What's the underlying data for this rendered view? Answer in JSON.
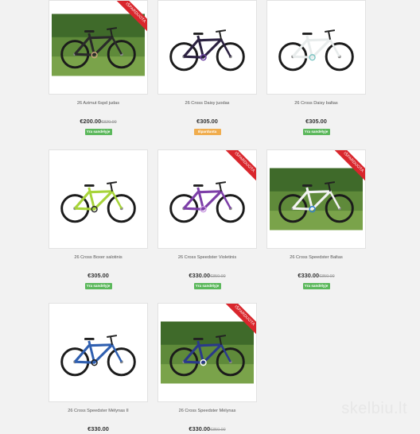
{
  "colors": {
    "in_stock": "#5cb85c",
    "preorder": "#f0ad4e",
    "ribbon": "#d9262c"
  },
  "ribbon_label": "IŠPARDUOTA",
  "products": [
    {
      "name": "26 Azimut 6spd judas",
      "price": "€200.00",
      "old_price": "€320.00",
      "badge": "Yra sandėlyje",
      "badge_type": "in_stock",
      "ribbon": true,
      "photo": "outdoor-photo",
      "frame_color": "#2a2a2a",
      "accent": "#c7a27a"
    },
    {
      "name": "26 Cross Daisy juodas",
      "price": "€305.00",
      "old_price": "",
      "badge": "Išparduota",
      "badge_type": "preorder",
      "ribbon": false,
      "photo": "white",
      "frame_color": "#2b2140",
      "accent": "#6b3fa0"
    },
    {
      "name": "26 Cross Daisy baltas",
      "price": "€305.00",
      "old_price": "",
      "badge": "Yra sandėlyje",
      "badge_type": "in_stock",
      "ribbon": false,
      "photo": "white",
      "frame_color": "#e8ecec",
      "accent": "#7fc6c4"
    },
    {
      "name": "26 Cross Boxer salotinis",
      "price": "€305.00",
      "old_price": "",
      "badge": "Yra sandėlyje",
      "badge_type": "in_stock",
      "ribbon": false,
      "photo": "white",
      "frame_color": "#a7d43a",
      "accent": "#2a2a2a"
    },
    {
      "name": "26 Cross Speedster Violetinis",
      "price": "€330.00",
      "old_price": "€350.00",
      "badge": "Yra sandėlyje",
      "badge_type": "in_stock",
      "ribbon": true,
      "photo": "white",
      "frame_color": "#7d3fa8",
      "accent": "#c99ae0"
    },
    {
      "name": "26 Cross Speedster Baltas",
      "price": "€330.00",
      "old_price": "€350.00",
      "badge": "Yra sandėlyje",
      "badge_type": "in_stock",
      "ribbon": true,
      "photo": "outdoor-photo",
      "frame_color": "#f2f2f2",
      "accent": "#2f7fd0"
    },
    {
      "name": "26 Cross Speedster Mėlynas II",
      "price": "€330.00",
      "old_price": "",
      "badge": "",
      "badge_type": "",
      "ribbon": false,
      "photo": "white",
      "frame_color": "#2f5fb0",
      "accent": "#1a1a1a"
    },
    {
      "name": "26 Cross Speedster Mėlynas",
      "price": "€330.00",
      "old_price": "€350.00",
      "badge": "",
      "badge_type": "",
      "ribbon": true,
      "photo": "outdoor-photo",
      "frame_color": "#2a3a8a",
      "accent": "#ffffff"
    }
  ],
  "watermark": "skelbiu.lt"
}
